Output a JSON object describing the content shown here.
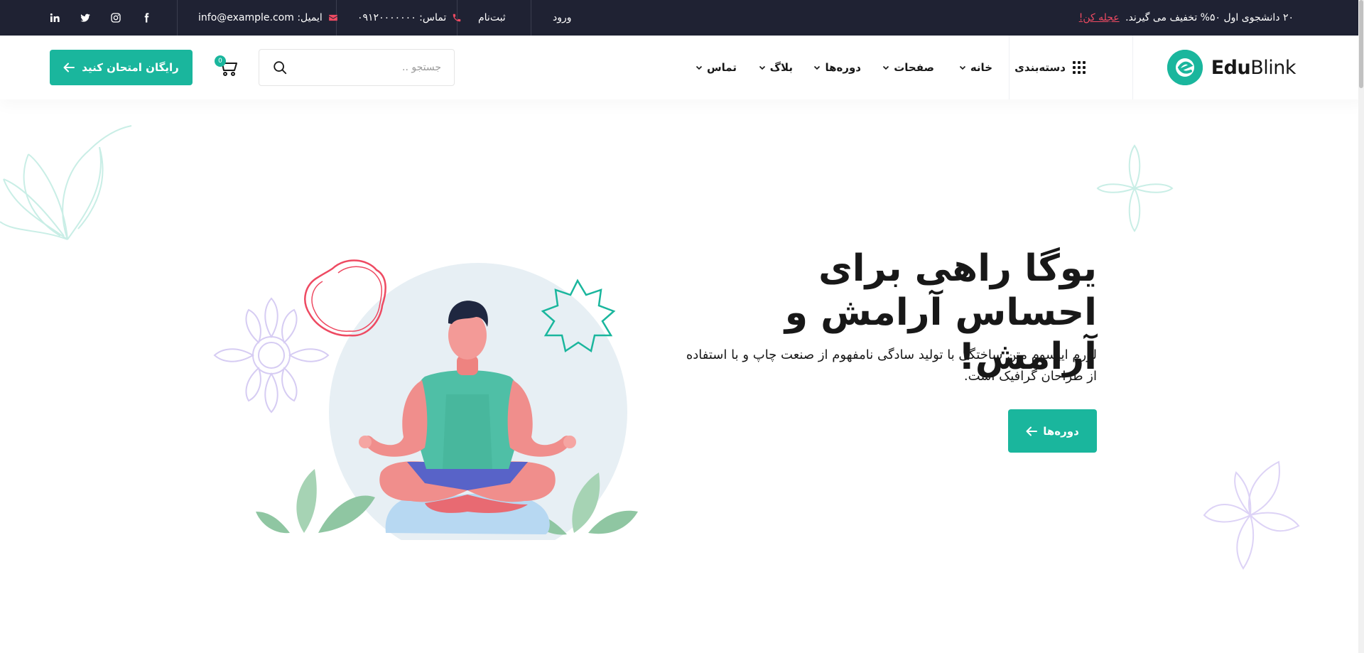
{
  "topbar": {
    "promo_text": "۲۰ دانشجوی اول ۵۰% تخفیف می گیرند.",
    "promo_link": "عجله کن!",
    "login": "ورود",
    "register": "ثبت‌نام",
    "phone_label": "تماس: ۰۹۱۲۰۰۰۰۰۰۰",
    "email_label": "ایمیل: info@example.com",
    "socials": [
      "facebook-icon",
      "instagram-icon",
      "twitter-icon",
      "linkedin-icon"
    ]
  },
  "header": {
    "logo_bold": "Edu",
    "logo_light": "Blink",
    "category": "دسته‌بندی",
    "nav": [
      "خانه",
      "صفحات",
      "دوره‌ها",
      "بلاگ",
      "تماس"
    ],
    "search_placeholder": "جستجو ..",
    "cart_count": "0",
    "cta": "رایگان امتحان کنید"
  },
  "hero": {
    "title": "یوگا راهی برای احساس آرامش و آرامش!",
    "description": "لورم ایپسوم متن ساختگی با تولید سادگی نامفهوم از صنعت چاپ و با استفاده از طراحان گرافیک است.",
    "button": "دوره‌ها"
  },
  "colors": {
    "accent": "#1ab69d",
    "topbar_bg": "#1f2233",
    "link_red": "#ee4a62"
  }
}
